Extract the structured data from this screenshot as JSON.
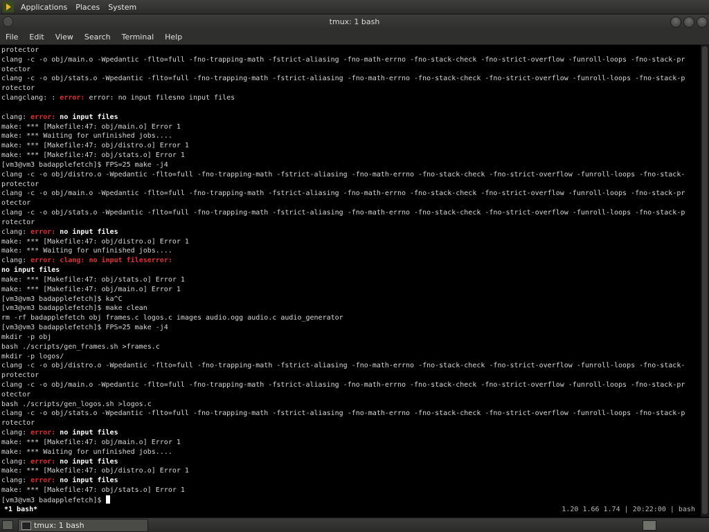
{
  "panel": {
    "menus": [
      "Applications",
      "Places",
      "System"
    ]
  },
  "window": {
    "title": "tmux: 1 bash"
  },
  "menubar": {
    "items": [
      "File",
      "Edit",
      "View",
      "Search",
      "Terminal",
      "Help"
    ]
  },
  "terminal": {
    "lines": [
      [
        {
          "t": "protector"
        }
      ],
      [
        {
          "t": "clang -c -o obj/main.o -Wpedantic -flto=full -fno-trapping-math -fstrict-aliasing -fno-math-errno -fno-stack-check -fno-strict-overflow -funroll-loops -fno-stack-pr"
        }
      ],
      [
        {
          "t": "otector"
        }
      ],
      [
        {
          "t": "clang -c -o obj/stats.o -Wpedantic -flto=full -fno-trapping-math -fstrict-aliasing -fno-math-errno -fno-stack-check -fno-strict-overflow -funroll-loops -fno-stack-p"
        }
      ],
      [
        {
          "t": "rotector"
        }
      ],
      [
        {
          "t": "clangclang: : "
        },
        {
          "t": "error:",
          "c": "err"
        },
        {
          "t": " error: no input filesno input files"
        }
      ],
      [
        {
          "t": ""
        }
      ],
      [
        {
          "t": "clang: "
        },
        {
          "t": "error:",
          "c": "err"
        },
        {
          "t": " no input files",
          "c": "bold"
        }
      ],
      [
        {
          "t": "make: *** [Makefile:47: obj/main.o] Error 1"
        }
      ],
      [
        {
          "t": "make: *** Waiting for unfinished jobs...."
        }
      ],
      [
        {
          "t": "make: *** [Makefile:47: obj/distro.o] Error 1"
        }
      ],
      [
        {
          "t": "make: *** [Makefile:47: obj/stats.o] Error 1"
        }
      ],
      [
        {
          "t": "[vm3@vm3 badapplefetch]$ FPS=25 make -j4"
        }
      ],
      [
        {
          "t": "clang -c -o obj/distro.o -Wpedantic -flto=full -fno-trapping-math -fstrict-aliasing -fno-math-errno -fno-stack-check -fno-strict-overflow -funroll-loops -fno-stack-"
        }
      ],
      [
        {
          "t": "protector"
        }
      ],
      [
        {
          "t": "clang -c -o obj/main.o -Wpedantic -flto=full -fno-trapping-math -fstrict-aliasing -fno-math-errno -fno-stack-check -fno-strict-overflow -funroll-loops -fno-stack-pr"
        }
      ],
      [
        {
          "t": "otector"
        }
      ],
      [
        {
          "t": "clang -c -o obj/stats.o -Wpedantic -flto=full -fno-trapping-math -fstrict-aliasing -fno-math-errno -fno-stack-check -fno-strict-overflow -funroll-loops -fno-stack-p"
        }
      ],
      [
        {
          "t": "rotector"
        }
      ],
      [
        {
          "t": "clang: "
        },
        {
          "t": "error:",
          "c": "err"
        },
        {
          "t": " no input files",
          "c": "bold"
        }
      ],
      [
        {
          "t": "make: *** [Makefile:47: obj/distro.o] Error 1"
        }
      ],
      [
        {
          "t": "make: *** Waiting for unfinished jobs...."
        }
      ],
      [
        {
          "t": "clang: "
        },
        {
          "t": "error: clang: no input fileserror:",
          "c": "err"
        }
      ],
      [
        {
          "t": "no input files",
          "c": "bold"
        }
      ],
      [
        {
          "t": "make: *** [Makefile:47: obj/stats.o] Error 1"
        }
      ],
      [
        {
          "t": "make: *** [Makefile:47: obj/main.o] Error 1"
        }
      ],
      [
        {
          "t": "[vm3@vm3 badapplefetch]$ ka^C"
        }
      ],
      [
        {
          "t": "[vm3@vm3 badapplefetch]$ make clean"
        }
      ],
      [
        {
          "t": "rm -rf badapplefetch obj frames.c logos.c images audio.ogg audio.c audio_generator"
        }
      ],
      [
        {
          "t": "[vm3@vm3 badapplefetch]$ FPS=25 make -j4"
        }
      ],
      [
        {
          "t": "mkdir -p obj"
        }
      ],
      [
        {
          "t": "bash ./scripts/gen_frames.sh >frames.c"
        }
      ],
      [
        {
          "t": "mkdir -p logos/"
        }
      ],
      [
        {
          "t": "clang -c -o obj/distro.o -Wpedantic -flto=full -fno-trapping-math -fstrict-aliasing -fno-math-errno -fno-stack-check -fno-strict-overflow -funroll-loops -fno-stack-"
        }
      ],
      [
        {
          "t": "protector"
        }
      ],
      [
        {
          "t": "clang -c -o obj/main.o -Wpedantic -flto=full -fno-trapping-math -fstrict-aliasing -fno-math-errno -fno-stack-check -fno-strict-overflow -funroll-loops -fno-stack-pr"
        }
      ],
      [
        {
          "t": "otector"
        }
      ],
      [
        {
          "t": "bash ./scripts/gen_logos.sh >logos.c"
        }
      ],
      [
        {
          "t": "clang -c -o obj/stats.o -Wpedantic -flto=full -fno-trapping-math -fstrict-aliasing -fno-math-errno -fno-stack-check -fno-strict-overflow -funroll-loops -fno-stack-p"
        }
      ],
      [
        {
          "t": "rotector"
        }
      ],
      [
        {
          "t": "clang: "
        },
        {
          "t": "error:",
          "c": "err"
        },
        {
          "t": " no input files",
          "c": "bold"
        }
      ],
      [
        {
          "t": "make: *** [Makefile:47: obj/main.o] Error 1"
        }
      ],
      [
        {
          "t": "make: *** Waiting for unfinished jobs...."
        }
      ],
      [
        {
          "t": "clang: "
        },
        {
          "t": "error:",
          "c": "err"
        },
        {
          "t": " no input files",
          "c": "bold"
        }
      ],
      [
        {
          "t": "make: *** [Makefile:47: obj/distro.o] Error 1"
        }
      ],
      [
        {
          "t": "clang: "
        },
        {
          "t": "error:",
          "c": "err"
        },
        {
          "t": " no input files",
          "c": "bold"
        }
      ],
      [
        {
          "t": "make: *** [Makefile:47: obj/stats.o] Error 1"
        }
      ],
      [
        {
          "t": "[vm3@vm3 badapplefetch]$ "
        },
        {
          "t": "",
          "c": "cursor"
        }
      ]
    ]
  },
  "tmux": {
    "window_label": " *1 bash*",
    "status_right": "1.20 1.66 1.74 | 20:22:00 | bash"
  },
  "taskbar": {
    "item_label": "tmux: 1 bash"
  }
}
